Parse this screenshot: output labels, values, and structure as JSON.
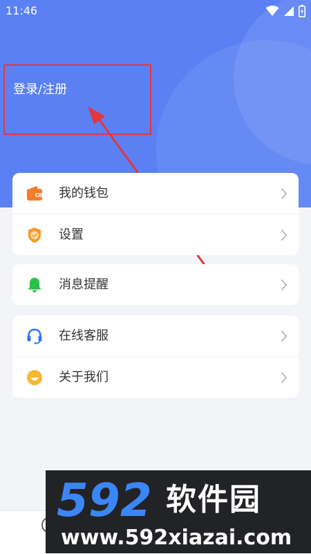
{
  "status_bar": {
    "time": "11:46",
    "icons": [
      "wifi-icon",
      "signal-icon",
      "battery-icon"
    ]
  },
  "header": {
    "login_label": "登录/注册"
  },
  "menu": {
    "group1": [
      {
        "label": "我的钱包",
        "icon": "wallet-icon"
      },
      {
        "label": "设置",
        "icon": "settings-badge-icon"
      }
    ],
    "group2": [
      {
        "label": "消息提醒",
        "icon": "bell-icon"
      }
    ],
    "group3": [
      {
        "label": "在线客服",
        "icon": "headset-icon"
      },
      {
        "label": "关于我们",
        "icon": "smile-icon"
      }
    ]
  },
  "watermark": {
    "logo_text": "592",
    "brand": "软件园",
    "url": "www.592xiazai.com"
  },
  "colors": {
    "header_blue": "#5a80f4",
    "annotation_red": "#e2373f",
    "wallet_orange": "#f57c2a",
    "settings_orange": "#f59a23",
    "bell_green": "#2bc14a",
    "headset_blue": "#2f74f0",
    "smile_yellow": "#f7b733",
    "watermark_blue": "#3b86f5"
  }
}
